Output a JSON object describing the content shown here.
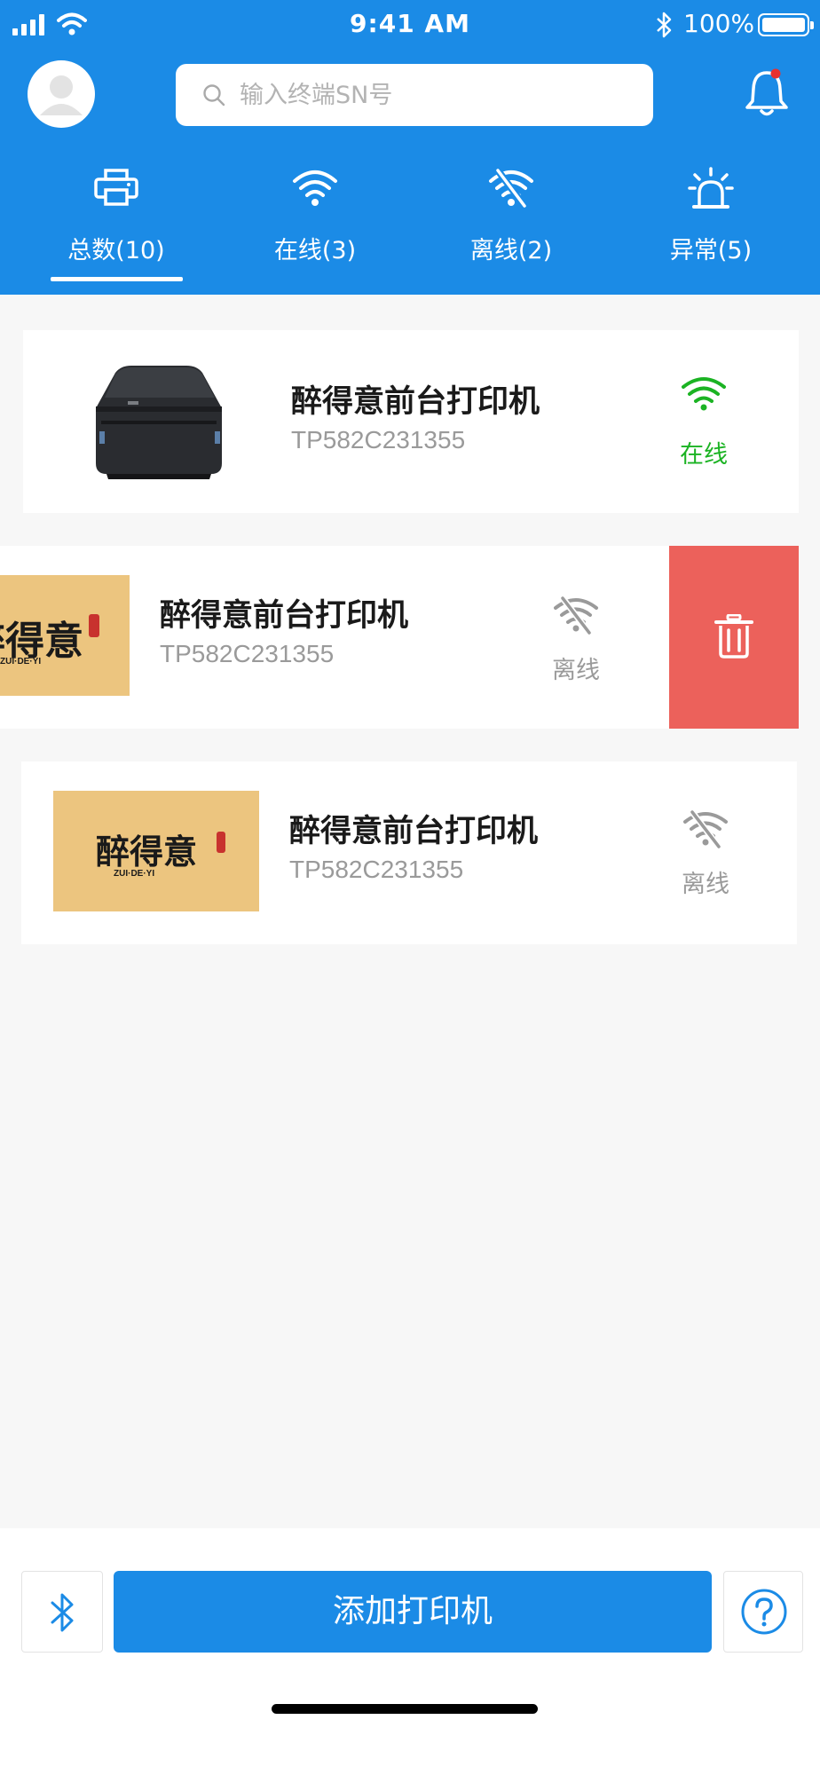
{
  "status_bar": {
    "time": "9:41 AM",
    "battery": "100%"
  },
  "search": {
    "placeholder": "输入终端SN号"
  },
  "tabs": [
    {
      "label": "总数(10)",
      "icon": "printer-icon",
      "active": true
    },
    {
      "label": "在线(3)",
      "icon": "wifi-icon"
    },
    {
      "label": "离线(2)",
      "icon": "wifi-off-icon"
    },
    {
      "label": "异常(5)",
      "icon": "alarm-icon"
    }
  ],
  "printers": [
    {
      "name": "醉得意前台打印机",
      "sn": "TP582C231355",
      "status": "在线",
      "image": "printer-photo"
    },
    {
      "name": "醉得意前台打印机",
      "sn": "TP582C231355",
      "status": "离线",
      "image": "zuideyi-logo",
      "swiped": true
    },
    {
      "name": "醉得意前台打印机",
      "sn": "TP582C231355",
      "status": "离线",
      "image": "zuideyi-logo"
    }
  ],
  "logo": {
    "text": "醉得意",
    "sub": "ZUI·DE·YI"
  },
  "bottom": {
    "add_label": "添加打印机"
  },
  "colors": {
    "primary": "#1b8be6",
    "online": "#1bb323",
    "offline": "#9a9a9a",
    "delete": "#ec615b"
  }
}
